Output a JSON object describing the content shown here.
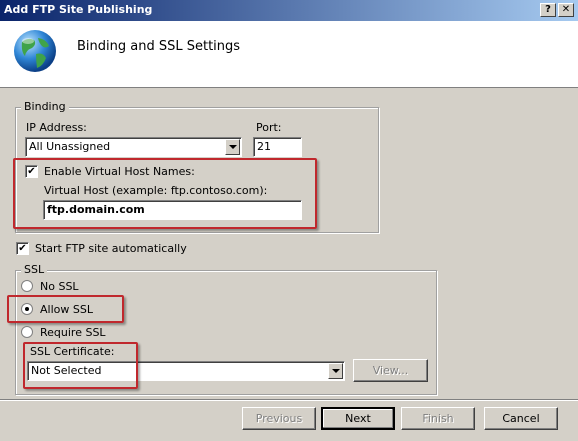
{
  "window": {
    "title": "Add FTP Site Publishing",
    "help_glyph": "?",
    "close_glyph": "✕"
  },
  "header": {
    "title": "Binding and SSL Settings",
    "icon": "globe-icon"
  },
  "binding": {
    "legend": "Binding",
    "ip_label": "IP Address:",
    "ip_value": "All Unassigned",
    "port_label": "Port:",
    "port_value": "21",
    "enable_vhost_label": "Enable Virtual Host Names:",
    "enable_vhost_checked": true,
    "vhost_label": "Virtual Host (example: ftp.contoso.com):",
    "vhost_value": "ftp.domain.com"
  },
  "start_auto": {
    "label": "Start FTP site automatically",
    "checked": true
  },
  "ssl": {
    "legend": "SSL",
    "options": [
      "No SSL",
      "Allow SSL",
      "Require SSL"
    ],
    "selected": "Allow SSL",
    "cert_label": "SSL Certificate:",
    "cert_value": "Not Selected",
    "view_label": "View..."
  },
  "buttons": {
    "previous": "Previous",
    "next": "Next",
    "finish": "Finish",
    "cancel": "Cancel"
  },
  "colors": {
    "highlight_box": "#c0282d",
    "dialog_bg": "#d4d0c8"
  }
}
